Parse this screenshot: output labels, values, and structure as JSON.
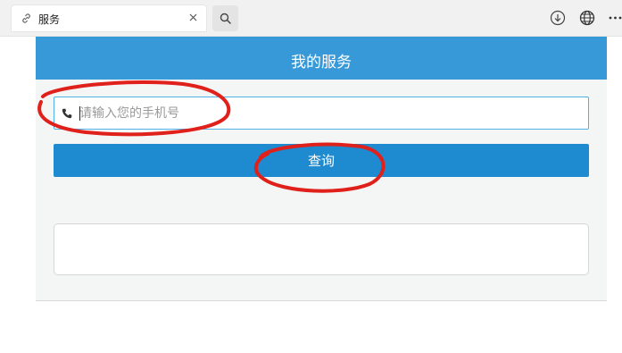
{
  "browser": {
    "tab": {
      "title": "服务",
      "icon": "link-icon"
    },
    "toolbar_icons": [
      "search-icon",
      "download-icon",
      "globe-icon",
      "more-icon"
    ]
  },
  "page": {
    "header_title": "我的服务",
    "phone_input": {
      "placeholder": "请输入您的手机号",
      "value": ""
    },
    "query_button_label": "查询",
    "result_text": ""
  },
  "colors": {
    "header_bg": "#3799d7",
    "button_bg": "#1e8ad0",
    "input_border": "#4fb1e8",
    "annotation_red": "#e0201a"
  }
}
